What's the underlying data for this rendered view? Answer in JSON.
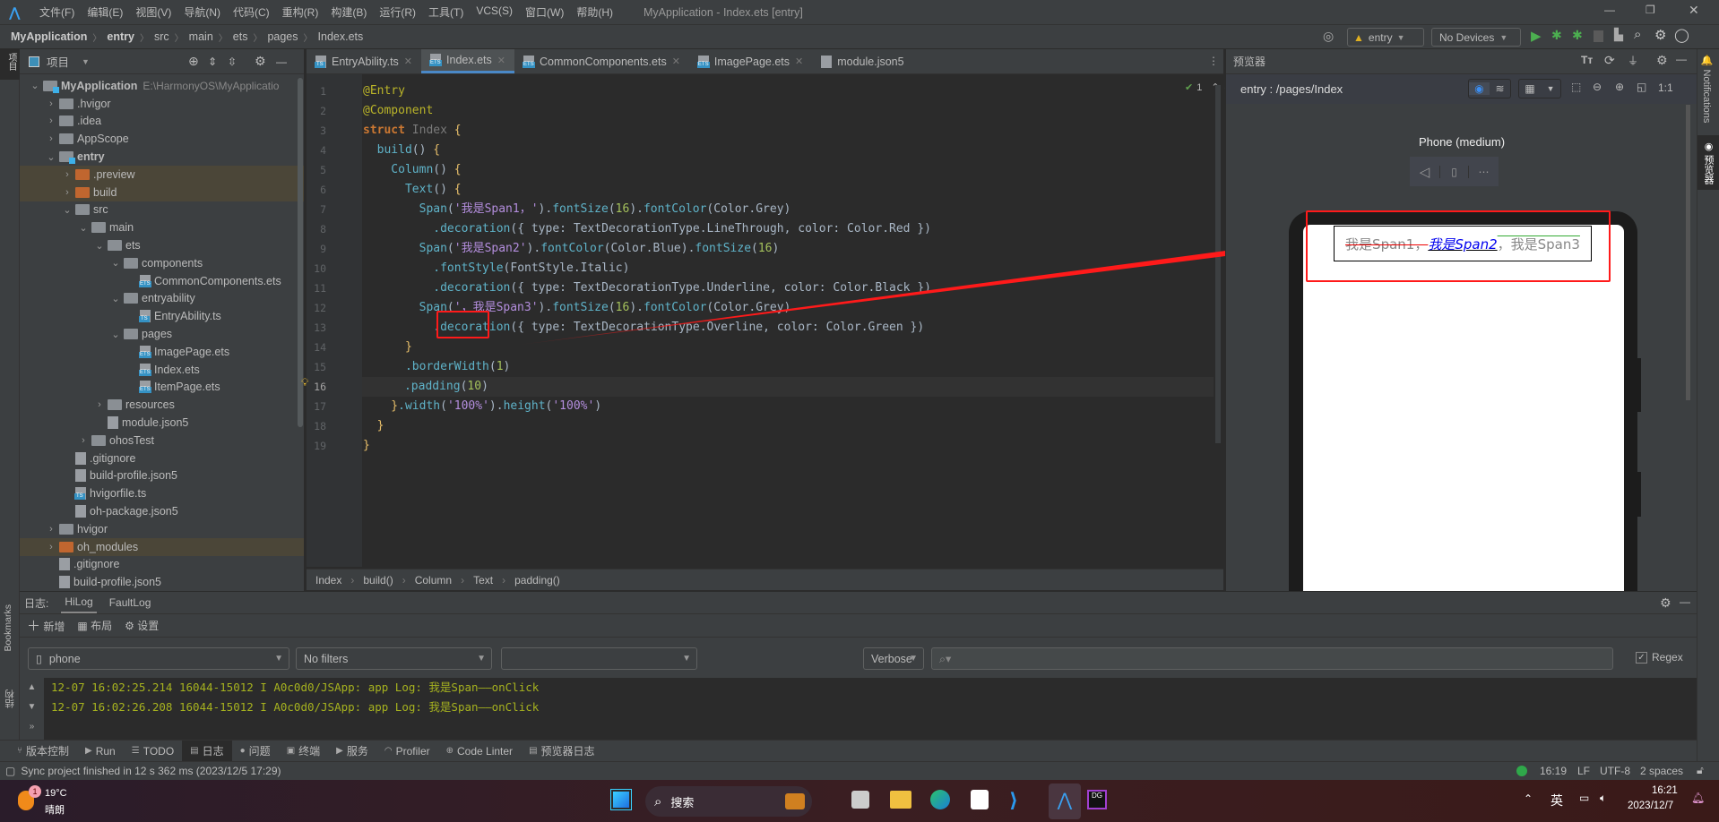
{
  "titlebar": {
    "menu": [
      "文件(F)",
      "编辑(E)",
      "视图(V)",
      "导航(N)",
      "代码(C)",
      "重构(R)",
      "构建(B)",
      "运行(R)",
      "工具(T)",
      "VCS(S)",
      "窗口(W)",
      "帮助(H)"
    ],
    "title": "MyApplication - Index.ets [entry]"
  },
  "breadcrumb": [
    "MyApplication",
    "entry",
    "src",
    "main",
    "ets",
    "pages",
    "Index.ets"
  ],
  "toolbar": {
    "module": "entry",
    "device": "No Devices"
  },
  "project": {
    "title": "项目",
    "stripe_label": "项目",
    "tree": [
      {
        "label": "MyApplication",
        "path": "E:\\HarmonyOS\\MyApplicatio",
        "depth": 0,
        "kind": "module",
        "chev": "down",
        "bold": true
      },
      {
        "label": ".hvigor",
        "depth": 1,
        "kind": "folder",
        "chev": "right"
      },
      {
        "label": ".idea",
        "depth": 1,
        "kind": "folder",
        "chev": "right"
      },
      {
        "label": "AppScope",
        "depth": 1,
        "kind": "folder",
        "chev": "right"
      },
      {
        "label": "entry",
        "depth": 1,
        "kind": "module",
        "chev": "down",
        "bold": true
      },
      {
        "label": ".preview",
        "depth": 2,
        "kind": "folder-orange",
        "chev": "right",
        "hl": true
      },
      {
        "label": "build",
        "depth": 2,
        "kind": "folder-orange",
        "chev": "right",
        "hl": true
      },
      {
        "label": "src",
        "depth": 2,
        "kind": "folder",
        "chev": "down"
      },
      {
        "label": "main",
        "depth": 3,
        "kind": "folder",
        "chev": "down"
      },
      {
        "label": "ets",
        "depth": 4,
        "kind": "folder",
        "chev": "down"
      },
      {
        "label": "components",
        "depth": 5,
        "kind": "folder",
        "chev": "down"
      },
      {
        "label": "CommonComponents.ets",
        "depth": 6,
        "kind": "ets"
      },
      {
        "label": "entryability",
        "depth": 5,
        "kind": "folder",
        "chev": "down"
      },
      {
        "label": "EntryAbility.ts",
        "depth": 6,
        "kind": "ts"
      },
      {
        "label": "pages",
        "depth": 5,
        "kind": "folder",
        "chev": "down"
      },
      {
        "label": "ImagePage.ets",
        "depth": 6,
        "kind": "ets"
      },
      {
        "label": "Index.ets",
        "depth": 6,
        "kind": "ets"
      },
      {
        "label": "ItemPage.ets",
        "depth": 6,
        "kind": "ets"
      },
      {
        "label": "resources",
        "depth": 4,
        "kind": "folder",
        "chev": "right"
      },
      {
        "label": "module.json5",
        "depth": 4,
        "kind": "json"
      },
      {
        "label": "ohosTest",
        "depth": 3,
        "kind": "folder",
        "chev": "right"
      },
      {
        "label": ".gitignore",
        "depth": 2,
        "kind": "file"
      },
      {
        "label": "build-profile.json5",
        "depth": 2,
        "kind": "json"
      },
      {
        "label": "hvigorfile.ts",
        "depth": 2,
        "kind": "ts"
      },
      {
        "label": "oh-package.json5",
        "depth": 2,
        "kind": "json"
      },
      {
        "label": "hvigor",
        "depth": 1,
        "kind": "folder",
        "chev": "right"
      },
      {
        "label": "oh_modules",
        "depth": 1,
        "kind": "folder-orange",
        "chev": "right",
        "hl": true
      },
      {
        "label": ".gitignore",
        "depth": 1,
        "kind": "file"
      },
      {
        "label": "build-profile.json5",
        "depth": 1,
        "kind": "json"
      }
    ]
  },
  "editor": {
    "tabs": [
      {
        "label": "EntryAbility.ts",
        "kind": "ts"
      },
      {
        "label": "Index.ets",
        "kind": "ets",
        "active": true
      },
      {
        "label": "CommonComponents.ets",
        "kind": "ets"
      },
      {
        "label": "ImagePage.ets",
        "kind": "ets"
      },
      {
        "label": "module.json5",
        "kind": "json"
      }
    ],
    "inspection": "1",
    "current_line": 16,
    "lines": [
      [
        [
          "@Entry",
          "ann"
        ]
      ],
      [
        [
          "@Component",
          "ann"
        ]
      ],
      [
        [
          "struct ",
          "kw"
        ],
        [
          "Index ",
          "cls"
        ],
        [
          "{",
          "br"
        ]
      ],
      [
        [
          "  build",
          "fn"
        ],
        [
          "() ",
          "def"
        ],
        [
          "{",
          "br"
        ]
      ],
      [
        [
          "    Column",
          "fn"
        ],
        [
          "() ",
          "def"
        ],
        [
          "{",
          "br"
        ]
      ],
      [
        [
          "      Text",
          "fn"
        ],
        [
          "() ",
          "def"
        ],
        [
          "{",
          "br"
        ]
      ],
      [
        [
          "        Span",
          "fn"
        ],
        [
          "(",
          "def"
        ],
        [
          "'我是Span1，'",
          "str"
        ],
        [
          ").",
          "def"
        ],
        [
          "fontSize",
          "fn"
        ],
        [
          "(",
          "def"
        ],
        [
          "16",
          "num"
        ],
        [
          ").",
          "def"
        ],
        [
          "fontColor",
          "fn"
        ],
        [
          "(Color.Grey)",
          "def"
        ]
      ],
      [
        [
          "          .decoration",
          "fn"
        ],
        [
          "({ type: TextDecorationType.LineThrough, color: Color.Red })",
          "def"
        ]
      ],
      [
        [
          "        Span",
          "fn"
        ],
        [
          "(",
          "def"
        ],
        [
          "'我是Span2'",
          "str"
        ],
        [
          ").",
          "def"
        ],
        [
          "fontColor",
          "fn"
        ],
        [
          "(Color.Blue).",
          "def"
        ],
        [
          "fontSize",
          "fn"
        ],
        [
          "(",
          "def"
        ],
        [
          "16",
          "num"
        ],
        [
          ")",
          "def"
        ]
      ],
      [
        [
          "          .fontStyle",
          "fn"
        ],
        [
          "(FontStyle.Italic)",
          "def"
        ]
      ],
      [
        [
          "          .decoration",
          "fn"
        ],
        [
          "({ type: TextDecorationType.Underline, color: Color.Black })",
          "def"
        ]
      ],
      [
        [
          "        Span",
          "fn"
        ],
        [
          "(",
          "def"
        ],
        [
          "'，我是Span3'",
          "str"
        ],
        [
          ").",
          "def"
        ],
        [
          "fontSize",
          "fn"
        ],
        [
          "(",
          "def"
        ],
        [
          "16",
          "num"
        ],
        [
          ").",
          "def"
        ],
        [
          "fontColor",
          "fn"
        ],
        [
          "(Color.Grey)",
          "def"
        ]
      ],
      [
        [
          "          .decoration",
          "fn"
        ],
        [
          "({ type: TextDecorationType.Overline, color: Color.Green })",
          "def"
        ]
      ],
      [
        [
          "      }",
          "br"
        ]
      ],
      [
        [
          "      .borderWidth",
          "fn"
        ],
        [
          "(",
          "def"
        ],
        [
          "1",
          "num"
        ],
        [
          ")",
          "def"
        ]
      ],
      [
        [
          "      .padding",
          "fn"
        ],
        [
          "(",
          "def"
        ],
        [
          "10",
          "num"
        ],
        [
          ")",
          "def"
        ]
      ],
      [
        [
          "    }",
          "br"
        ],
        [
          ".width",
          "fn"
        ],
        [
          "(",
          "def"
        ],
        [
          "'100%'",
          "str"
        ],
        [
          ").",
          "def"
        ],
        [
          "height",
          "fn"
        ],
        [
          "(",
          "def"
        ],
        [
          "'100%'",
          "str"
        ],
        [
          ")",
          "def"
        ]
      ],
      [
        [
          "  }",
          "br"
        ]
      ],
      [
        [
          "}",
          "br"
        ]
      ]
    ],
    "crumbs": [
      "Index",
      "build()",
      "Column",
      "Text",
      "padding()"
    ]
  },
  "preview": {
    "title": "预览器",
    "route": "entry : /pages/Index",
    "device_name": "Phone (medium)",
    "zoom_label": "1:1",
    "spans": [
      {
        "text": "我是Span1，",
        "style": "line-through red grey"
      },
      {
        "text": "我是Span2",
        "style": "italic underline blue"
      },
      {
        "text": "，我是Span3",
        "style": "overline green grey"
      }
    ]
  },
  "right_stripe": {
    "notifications": "Notifications",
    "previewer": "预览器"
  },
  "left_bottom_stripe": {
    "bookmarks": "Bookmarks",
    "structure": "结构"
  },
  "log": {
    "label": "日志:",
    "tabs": [
      "HiLog",
      "FaultLog"
    ],
    "actions": [
      "新增",
      "布局",
      "设置"
    ],
    "device": "phone",
    "filter": "No filters",
    "process": "",
    "level": "Verbose",
    "search_placeholder": "",
    "regex_label": "Regex",
    "regex_checked": true,
    "lines": [
      "12-07 16:02:25.214 16044-15012 I A0c0d0/JSApp: app Log: 我是Span——onClick",
      "12-07 16:02:26.208 16044-15012 I A0c0d0/JSApp: app Log: 我是Span——onClick"
    ]
  },
  "bottom_tools": [
    "版本控制",
    "Run",
    "TODO",
    "日志",
    "问题",
    "终端",
    "服务",
    "Profiler",
    "Code Linter",
    "预览器日志"
  ],
  "status": {
    "message": "Sync project finished in 12 s 362 ms (2023/12/5 17:29)",
    "position": "16:19",
    "line_sep": "LF",
    "encoding": "UTF-8",
    "indent": "2 spaces"
  },
  "taskbar": {
    "weather_temp": "19°C",
    "weather_desc": "晴朗",
    "weather_badge": "1",
    "search": "搜索",
    "ime": "英",
    "time": "16:21",
    "date": "2023/12/7"
  },
  "colors": {
    "accent": "#4a88c7",
    "annotation_red": "#ff1a1a",
    "log_text": "#a6b21f"
  }
}
